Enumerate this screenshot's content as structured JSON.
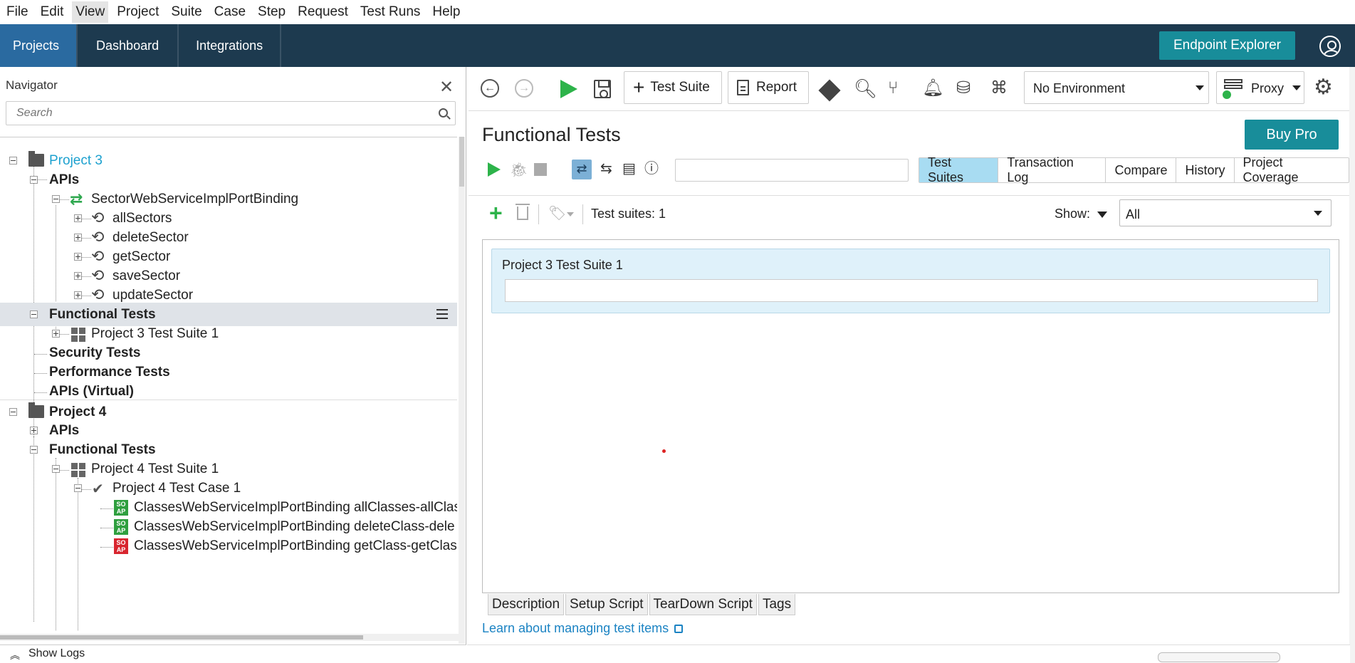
{
  "menu": [
    "File",
    "Edit",
    "View",
    "Project",
    "Suite",
    "Case",
    "Step",
    "Request",
    "Test Runs",
    "Help"
  ],
  "menu_active": "View",
  "topnav": {
    "tabs": [
      "Projects",
      "Dashboard",
      "Integrations"
    ],
    "active_tab": "Projects",
    "endpoint_explorer": "Endpoint Explorer"
  },
  "navigator": {
    "title": "Navigator",
    "search_placeholder": "Search",
    "tree": [
      {
        "label": "Project 3",
        "style": "blue"
      },
      {
        "label": "APIs",
        "style": "bold"
      },
      {
        "label": "SectorWebServiceImplPortBinding"
      },
      {
        "label": "allSectors"
      },
      {
        "label": "deleteSector"
      },
      {
        "label": "getSector"
      },
      {
        "label": "saveSector"
      },
      {
        "label": "updateSector"
      },
      {
        "label": "Functional Tests",
        "style": "bold",
        "selected": true
      },
      {
        "label": "Project 3 Test Suite 1"
      },
      {
        "label": "Security Tests",
        "style": "bold"
      },
      {
        "label": "Performance Tests",
        "style": "bold"
      },
      {
        "label": "APIs (Virtual)",
        "style": "bold"
      },
      {
        "label": "Project 4",
        "style": "bold"
      },
      {
        "label": "APIs",
        "style": "bold"
      },
      {
        "label": "Functional Tests",
        "style": "bold"
      },
      {
        "label": "Project 4 Test Suite 1"
      },
      {
        "label": "Project 4 Test Case 1"
      },
      {
        "label": "ClassesWebServiceImplPortBinding allClasses-allClas"
      },
      {
        "label": "ClassesWebServiceImplPortBinding deleteClass-dele"
      },
      {
        "label": "ClassesWebServiceImplPortBinding getClass-getClas"
      }
    ],
    "soap_icon_text": "SO AP",
    "show_logs": "Show Logs"
  },
  "toolbar": {
    "test_suite_btn": "Test Suite",
    "report_btn": "Report",
    "environment": "No Environment",
    "proxy": "Proxy"
  },
  "content": {
    "title": "Functional Tests",
    "buy_pro": "Buy Pro",
    "view_tabs": [
      "Test Suites",
      "Transaction Log",
      "Compare",
      "History",
      "Project Coverage"
    ],
    "active_view_tab": "Test Suites",
    "count_label": "Test suites: 1",
    "show_label": "Show:",
    "filter_value": "All",
    "suites": [
      "Project 3 Test Suite 1"
    ],
    "bottom_tabs": [
      "Description",
      "Setup Script",
      "TearDown Script",
      "Tags"
    ],
    "learn_link": "Learn about managing test items"
  },
  "colors": {
    "nav_bg": "#1d3a4f",
    "active_tab": "#2a6aa0",
    "accent_teal": "#188d9a",
    "run_green": "#2db34a",
    "link_blue": "#1b83c3"
  }
}
